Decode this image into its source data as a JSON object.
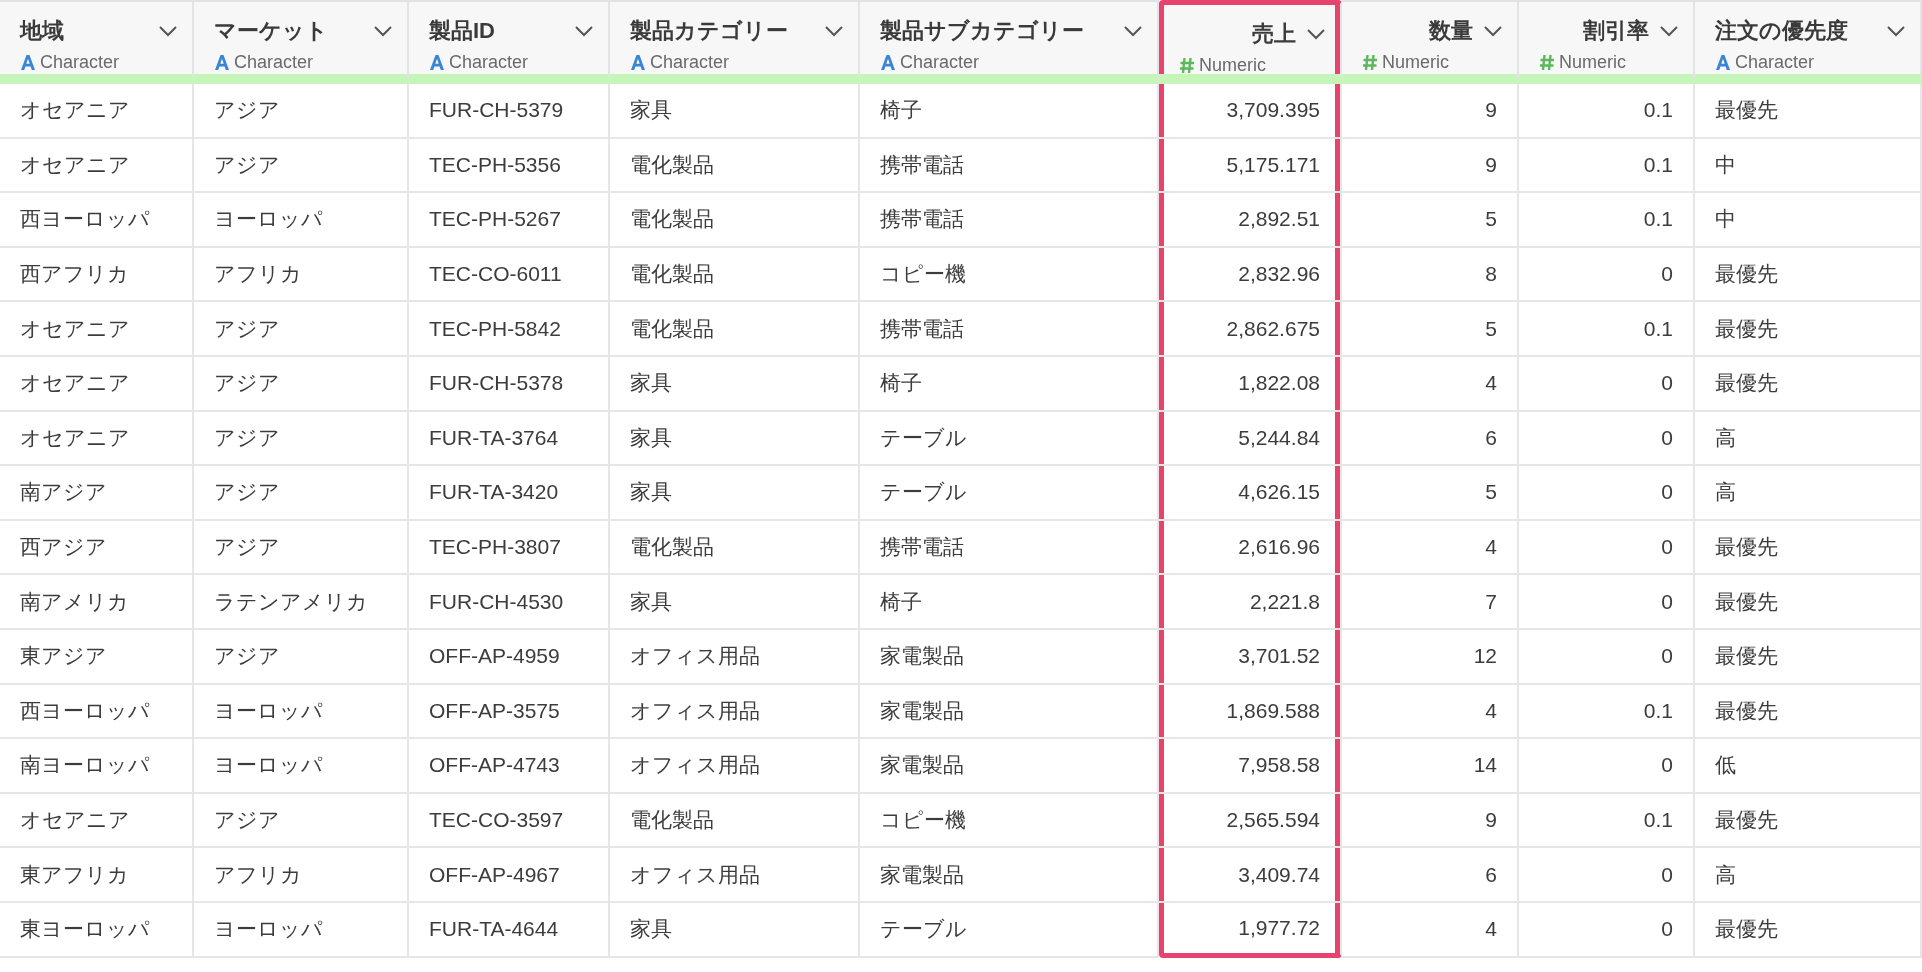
{
  "table": {
    "columns": [
      {
        "name": "地域",
        "type": "Character",
        "kind": "character",
        "selected": false
      },
      {
        "name": "マーケット",
        "type": "Character",
        "kind": "character",
        "selected": false
      },
      {
        "name": "製品ID",
        "type": "Character",
        "kind": "character",
        "selected": false
      },
      {
        "name": "製品カテゴリー",
        "type": "Character",
        "kind": "character",
        "selected": false
      },
      {
        "name": "製品サブカテゴリー",
        "type": "Character",
        "kind": "character",
        "selected": false
      },
      {
        "name": "売上",
        "type": "Numeric",
        "kind": "numeric",
        "selected": true
      },
      {
        "name": "数量",
        "type": "Numeric",
        "kind": "numeric",
        "selected": false
      },
      {
        "name": "割引率",
        "type": "Numeric",
        "kind": "numeric",
        "selected": false
      },
      {
        "name": "注文の優先度",
        "type": "Character",
        "kind": "character",
        "selected": false
      }
    ],
    "rows": [
      [
        "オセアニア",
        "アジア",
        "FUR-CH-5379",
        "家具",
        "椅子",
        "3,709.395",
        "9",
        "0.1",
        "最優先"
      ],
      [
        "オセアニア",
        "アジア",
        "TEC-PH-5356",
        "電化製品",
        "携帯電話",
        "5,175.171",
        "9",
        "0.1",
        "中"
      ],
      [
        "西ヨーロッパ",
        "ヨーロッパ",
        "TEC-PH-5267",
        "電化製品",
        "携帯電話",
        "2,892.51",
        "5",
        "0.1",
        "中"
      ],
      [
        "西アフリカ",
        "アフリカ",
        "TEC-CO-6011",
        "電化製品",
        "コピー機",
        "2,832.96",
        "8",
        "0",
        "最優先"
      ],
      [
        "オセアニア",
        "アジア",
        "TEC-PH-5842",
        "電化製品",
        "携帯電話",
        "2,862.675",
        "5",
        "0.1",
        "最優先"
      ],
      [
        "オセアニア",
        "アジア",
        "FUR-CH-5378",
        "家具",
        "椅子",
        "1,822.08",
        "4",
        "0",
        "最優先"
      ],
      [
        "オセアニア",
        "アジア",
        "FUR-TA-3764",
        "家具",
        "テーブル",
        "5,244.84",
        "6",
        "0",
        "高"
      ],
      [
        "南アジア",
        "アジア",
        "FUR-TA-3420",
        "家具",
        "テーブル",
        "4,626.15",
        "5",
        "0",
        "高"
      ],
      [
        "西アジア",
        "アジア",
        "TEC-PH-3807",
        "電化製品",
        "携帯電話",
        "2,616.96",
        "4",
        "0",
        "最優先"
      ],
      [
        "南アメリカ",
        "ラテンアメリカ",
        "FUR-CH-4530",
        "家具",
        "椅子",
        "2,221.8",
        "7",
        "0",
        "最優先"
      ],
      [
        "東アジア",
        "アジア",
        "OFF-AP-4959",
        "オフィス用品",
        "家電製品",
        "3,701.52",
        "12",
        "0",
        "最優先"
      ],
      [
        "西ヨーロッパ",
        "ヨーロッパ",
        "OFF-AP-3575",
        "オフィス用品",
        "家電製品",
        "1,869.588",
        "4",
        "0.1",
        "最優先"
      ],
      [
        "南ヨーロッパ",
        "ヨーロッパ",
        "OFF-AP-4743",
        "オフィス用品",
        "家電製品",
        "7,958.58",
        "14",
        "0",
        "低"
      ],
      [
        "オセアニア",
        "アジア",
        "TEC-CO-3597",
        "電化製品",
        "コピー機",
        "2,565.594",
        "9",
        "0.1",
        "最優先"
      ],
      [
        "東アフリカ",
        "アフリカ",
        "OFF-AP-4967",
        "オフィス用品",
        "家電製品",
        "3,409.74",
        "6",
        "0",
        "高"
      ],
      [
        "東ヨーロッパ",
        "ヨーロッパ",
        "FUR-TA-4644",
        "家具",
        "テーブル",
        "1,977.72",
        "4",
        "0",
        "最優先"
      ]
    ]
  }
}
